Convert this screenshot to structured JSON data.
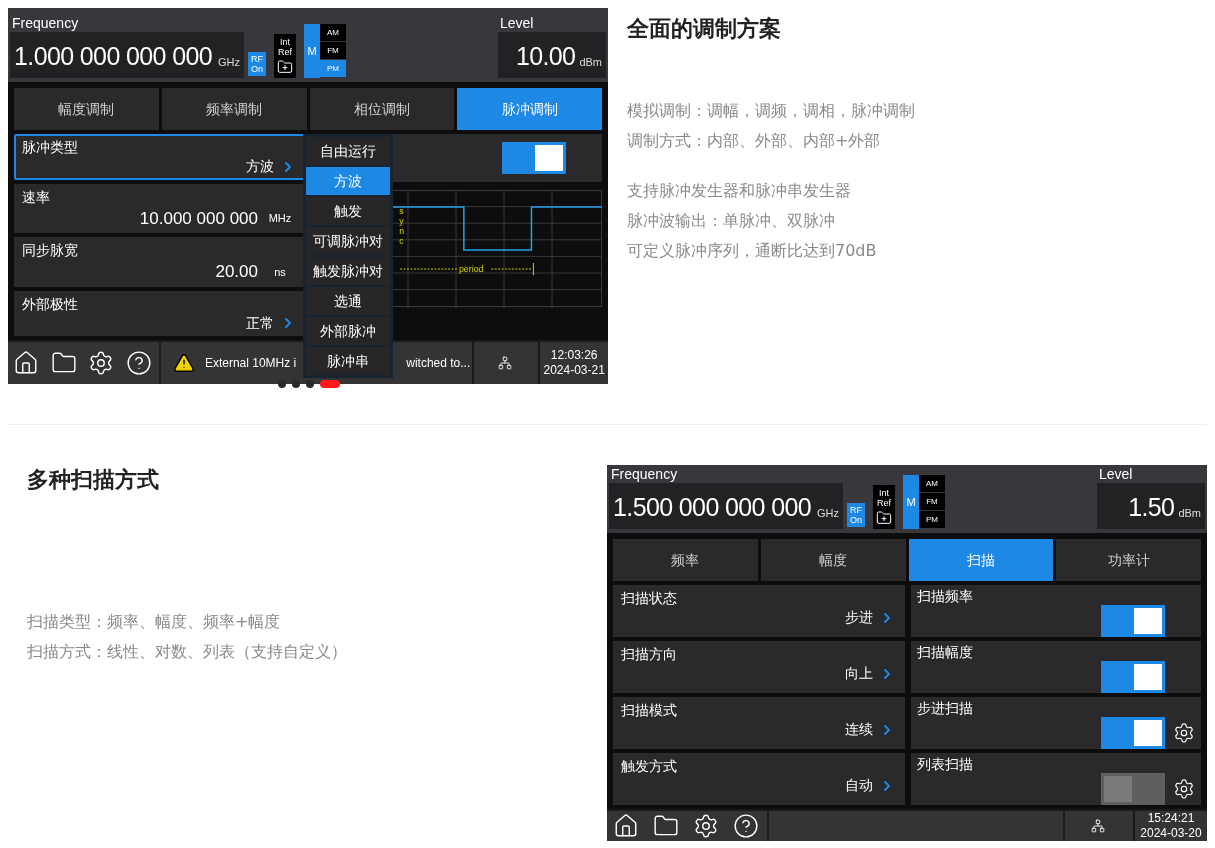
{
  "sections": [
    {
      "heading": "全面的调制方案",
      "paragraphs": [
        [
          "模拟调制：调幅，调频，调相，脉冲调制",
          "调制方式：内部、外部、内部+外部"
        ],
        [
          "支持脉冲发生器和脉冲串发生器",
          "脉冲波输出：单脉冲、双脉冲",
          "可定义脉冲序列，通断比达到70dB"
        ]
      ],
      "carousel_dots": [
        {
          "selected": false
        },
        {
          "selected": false
        },
        {
          "selected": false
        },
        {
          "selected": true
        }
      ],
      "instrument": {
        "frequency_label": "Frequency",
        "frequency": "1.000 000 000 000",
        "frequency_unit": "GHz",
        "rf_badge": [
          "RF",
          "On"
        ],
        "ref_badge": [
          "Int",
          "Ref"
        ],
        "mod_badge": "M",
        "modulations": [
          {
            "label": "AM",
            "selected": false
          },
          {
            "label": "FM",
            "selected": false
          },
          {
            "label": "PM",
            "selected": true
          }
        ],
        "level_label": "Level",
        "level": "10.00",
        "level_unit": "dBm",
        "tabs": [
          {
            "label": "幅度调制",
            "selected": false
          },
          {
            "label": "频率调制",
            "selected": false
          },
          {
            "label": "相位调制",
            "selected": false
          },
          {
            "label": "脉冲调制",
            "selected": true
          }
        ],
        "params": [
          {
            "kind": "menu",
            "label": "脉冲类型",
            "value": "方波",
            "focused": true
          },
          {
            "kind": "number",
            "label": "速率",
            "value": "10.000 000 000",
            "unit": "MHz",
            "focused": false
          },
          {
            "kind": "number",
            "label": "同步脉宽",
            "value": "20.00",
            "unit": "ns",
            "focused": false
          },
          {
            "kind": "menu",
            "label": "外部极性",
            "value": "正常",
            "focused": false
          }
        ],
        "switches": [
          {
            "on": true
          }
        ],
        "chart": {
          "sync_label": "sync",
          "period_label": "period"
        },
        "dropdown": [
          {
            "label": "自由运行",
            "selected": false
          },
          {
            "label": "方波",
            "selected": true
          },
          {
            "label": "触发",
            "selected": false
          },
          {
            "label": "可调脉冲对",
            "selected": false
          },
          {
            "label": "触发脉冲对",
            "selected": false
          },
          {
            "label": "选通",
            "selected": false
          },
          {
            "label": "外部脉冲",
            "selected": false
          },
          {
            "label": "脉冲串",
            "selected": false
          }
        ],
        "status_message": [
          "External 10MHz i",
          "witched to..."
        ],
        "time": "12:03:26",
        "date": "2024-03-21"
      }
    },
    {
      "heading": "多种扫描方式",
      "paragraphs": [
        [
          "扫描类型：频率、幅度、频率+幅度",
          "扫描方式：线性、对数、列表（支持自定义）"
        ]
      ],
      "instrument": {
        "frequency_label": "Frequency",
        "frequency": "1.500 000 000 000",
        "frequency_unit": "GHz",
        "rf_badge": [
          "RF",
          "On"
        ],
        "ref_badge": [
          "Int",
          "Ref"
        ],
        "mod_badge": "M",
        "modulations": [
          {
            "label": "AM",
            "selected": false
          },
          {
            "label": "FM",
            "selected": false
          },
          {
            "label": "PM",
            "selected": false
          }
        ],
        "level_label": "Level",
        "level": "1.50",
        "level_unit": "dBm",
        "tabs": [
          {
            "label": "频率",
            "selected": false
          },
          {
            "label": "幅度",
            "selected": false
          },
          {
            "label": "扫描",
            "selected": true
          },
          {
            "label": "功率计",
            "selected": false
          }
        ],
        "params": [
          {
            "kind": "menu",
            "label": "扫描状态",
            "value": "步进",
            "focused": false
          },
          {
            "kind": "menu",
            "label": "扫描方向",
            "value": "向上",
            "focused": false
          },
          {
            "kind": "menu",
            "label": "扫描模式",
            "value": "连续",
            "focused": false
          },
          {
            "kind": "menu",
            "label": "触发方式",
            "value": "自动",
            "focused": false
          }
        ],
        "switches": [
          {
            "label": "扫描频率",
            "on": true,
            "settings": false
          },
          {
            "label": "扫描幅度",
            "on": true,
            "settings": false
          },
          {
            "label": "步进扫描",
            "on": true,
            "settings": true
          },
          {
            "label": "列表扫描",
            "on": false,
            "settings": true
          }
        ],
        "time": "15:24:21",
        "date": "2024-03-20"
      }
    }
  ]
}
